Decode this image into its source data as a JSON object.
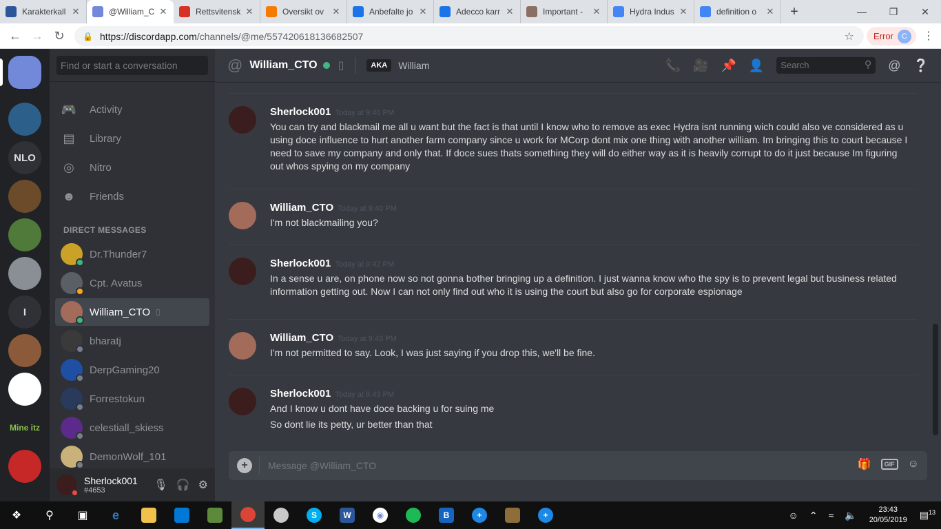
{
  "browser": {
    "tabs": [
      {
        "title": "Karakterkall",
        "icon": "word-doc-icon",
        "color": "#2b579a"
      },
      {
        "title": "@William_C",
        "icon": "discord-tab-icon",
        "color": "#7289da",
        "active": true
      },
      {
        "title": "Rettsvitensk",
        "icon": "red-flag-icon",
        "color": "#d93025"
      },
      {
        "title": "Oversikt ov",
        "icon": "u-logo-icon",
        "color": "#f57c00"
      },
      {
        "title": "Anbefalte jo",
        "icon": "info-pin-icon",
        "color": "#1a73e8"
      },
      {
        "title": "Adecco karr",
        "icon": "info-pin-icon",
        "color": "#1a73e8"
      },
      {
        "title": "Important -",
        "icon": "image-thumb-icon",
        "color": "#8d6e63"
      },
      {
        "title": "Hydra Indus",
        "icon": "docs-icon",
        "color": "#4285f4"
      },
      {
        "title": "definition o",
        "icon": "google-icon",
        "color": "#4285f4"
      }
    ],
    "url_host": "https://discordapp.com",
    "url_path": "/channels/@me/557420618136682507",
    "error_label": "Error",
    "profile_initial": "C"
  },
  "guilds": {
    "items": [
      {
        "label": "",
        "name": "guild-discord-home",
        "color": "#7289da"
      },
      {
        "label": "",
        "name": "guild-globe",
        "color": "#2c5f8a"
      },
      {
        "label": "NLO",
        "name": "guild-nlo",
        "color": "#2f3136"
      },
      {
        "label": "",
        "name": "guild-minecraft-block",
        "color": "#6b4b2a"
      },
      {
        "label": "",
        "name": "guild-landscape",
        "color": "#4f7a3a"
      },
      {
        "label": "",
        "name": "guild-town",
        "color": "#8a8f96"
      },
      {
        "label": "I",
        "name": "guild-i",
        "color": "#2f3136"
      },
      {
        "label": "",
        "name": "guild-arena",
        "color": "#8a5a3b"
      },
      {
        "label": "",
        "name": "guild-palm",
        "color": "#ffffff"
      },
      {
        "label": "Mine itz",
        "name": "guild-mineitz",
        "color": "#202225"
      },
      {
        "label": "",
        "name": "guild-hydra",
        "color": "#c62828"
      }
    ]
  },
  "sidebar": {
    "search_placeholder": "Find or start a conversation",
    "nav": [
      {
        "label": "Activity",
        "icon": "gamepad-icon"
      },
      {
        "label": "Library",
        "icon": "library-icon"
      },
      {
        "label": "Nitro",
        "icon": "nitro-icon"
      },
      {
        "label": "Friends",
        "icon": "friends-icon"
      }
    ],
    "dm_header": "DIRECT MESSAGES",
    "dms": [
      {
        "name": "Dr.Thunder7",
        "status": "#43b581",
        "avatar": "#c9a227"
      },
      {
        "name": "Cpt. Avatus",
        "status": "#faa61a",
        "avatar": "#5a5f66"
      },
      {
        "name": "William_CTO",
        "status": "#43b581",
        "avatar": "#a36b5a",
        "selected": true
      },
      {
        "name": "bharatj",
        "status": "#747f8d",
        "avatar": "#3a3a3a"
      },
      {
        "name": "DerpGaming20",
        "status": "#747f8d",
        "avatar": "#1e4fa3"
      },
      {
        "name": "Forrestokun",
        "status": "#747f8d",
        "avatar": "#2a3a5c"
      },
      {
        "name": "celestiall_skiess",
        "status": "#747f8d",
        "avatar": "#5b2a8a"
      },
      {
        "name": "DemonWolf_101",
        "status": "#747f8d",
        "avatar": "#c9b27a"
      }
    ],
    "user": {
      "name": "Sherlock001",
      "tag": "#4653"
    }
  },
  "chat": {
    "recipient": "William_CTO",
    "aka_label": "AKA",
    "aka_name": "William",
    "search_placeholder": "Search",
    "composer_placeholder": "Message @William_CTO",
    "messages": [
      {
        "user": "Sherlock001",
        "time": "Today at 9:40 PM",
        "avatar": "#3b1d1d",
        "lines": [
          "You can try and blackmail me all u want but the fact is that until I know who to remove as exec Hydra isnt running wich could also ve considered as u using doce influence to hurt another farm company since u work for MCorp dont mix one thing with another william. Im bringing this to court because I need to save my company and only that. If doce sues thats something they will do either way as it is heavily corrupt to do it just because Im figuring out whos spying on my company"
        ]
      },
      {
        "user": "William_CTO",
        "time": "Today at 9:40 PM",
        "avatar": "#a36b5a",
        "lines": [
          "I'm not blackmailing you?"
        ]
      },
      {
        "user": "Sherlock001",
        "time": "Today at 9:42 PM",
        "avatar": "#3b1d1d",
        "lines": [
          "In a sense u are, on phone now so not gonna bother bringing up a definition. I just wanna know who the spy is to prevent legal but business related information getting out. Now I can not only find out who it is using the court but also go for corporate espionage"
        ]
      },
      {
        "user": "William_CTO",
        "time": "Today at 9:43 PM",
        "avatar": "#a36b5a",
        "lines": [
          "I'm not permitted to say. Look, I was just saying if you drop this, we'll be fine."
        ]
      },
      {
        "user": "Sherlock001",
        "time": "Today at 9:43 PM",
        "avatar": "#3b1d1d",
        "lines": [
          "And I know u dont have doce backing u for suing me",
          "So dont lie its petty, ur better than that"
        ]
      }
    ]
  },
  "taskbar": {
    "time": "23:43",
    "date": "20/05/2019",
    "notifications": "13"
  }
}
